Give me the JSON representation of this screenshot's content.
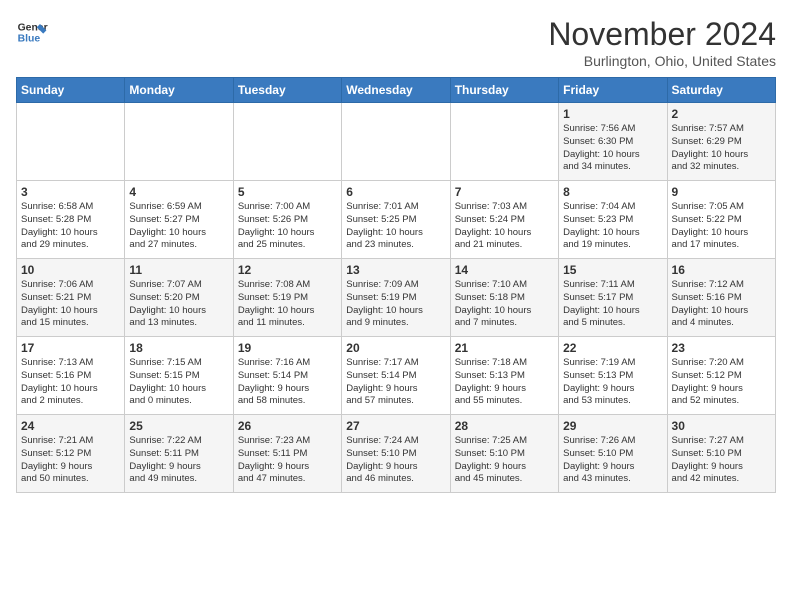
{
  "header": {
    "logo_line1": "General",
    "logo_line2": "Blue",
    "month_year": "November 2024",
    "location": "Burlington, Ohio, United States"
  },
  "days_of_week": [
    "Sunday",
    "Monday",
    "Tuesday",
    "Wednesday",
    "Thursday",
    "Friday",
    "Saturday"
  ],
  "weeks": [
    [
      {
        "day": "",
        "info": ""
      },
      {
        "day": "",
        "info": ""
      },
      {
        "day": "",
        "info": ""
      },
      {
        "day": "",
        "info": ""
      },
      {
        "day": "",
        "info": ""
      },
      {
        "day": "1",
        "info": "Sunrise: 7:56 AM\nSunset: 6:30 PM\nDaylight: 10 hours\nand 34 minutes."
      },
      {
        "day": "2",
        "info": "Sunrise: 7:57 AM\nSunset: 6:29 PM\nDaylight: 10 hours\nand 32 minutes."
      }
    ],
    [
      {
        "day": "3",
        "info": "Sunrise: 6:58 AM\nSunset: 5:28 PM\nDaylight: 10 hours\nand 29 minutes."
      },
      {
        "day": "4",
        "info": "Sunrise: 6:59 AM\nSunset: 5:27 PM\nDaylight: 10 hours\nand 27 minutes."
      },
      {
        "day": "5",
        "info": "Sunrise: 7:00 AM\nSunset: 5:26 PM\nDaylight: 10 hours\nand 25 minutes."
      },
      {
        "day": "6",
        "info": "Sunrise: 7:01 AM\nSunset: 5:25 PM\nDaylight: 10 hours\nand 23 minutes."
      },
      {
        "day": "7",
        "info": "Sunrise: 7:03 AM\nSunset: 5:24 PM\nDaylight: 10 hours\nand 21 minutes."
      },
      {
        "day": "8",
        "info": "Sunrise: 7:04 AM\nSunset: 5:23 PM\nDaylight: 10 hours\nand 19 minutes."
      },
      {
        "day": "9",
        "info": "Sunrise: 7:05 AM\nSunset: 5:22 PM\nDaylight: 10 hours\nand 17 minutes."
      }
    ],
    [
      {
        "day": "10",
        "info": "Sunrise: 7:06 AM\nSunset: 5:21 PM\nDaylight: 10 hours\nand 15 minutes."
      },
      {
        "day": "11",
        "info": "Sunrise: 7:07 AM\nSunset: 5:20 PM\nDaylight: 10 hours\nand 13 minutes."
      },
      {
        "day": "12",
        "info": "Sunrise: 7:08 AM\nSunset: 5:19 PM\nDaylight: 10 hours\nand 11 minutes."
      },
      {
        "day": "13",
        "info": "Sunrise: 7:09 AM\nSunset: 5:19 PM\nDaylight: 10 hours\nand 9 minutes."
      },
      {
        "day": "14",
        "info": "Sunrise: 7:10 AM\nSunset: 5:18 PM\nDaylight: 10 hours\nand 7 minutes."
      },
      {
        "day": "15",
        "info": "Sunrise: 7:11 AM\nSunset: 5:17 PM\nDaylight: 10 hours\nand 5 minutes."
      },
      {
        "day": "16",
        "info": "Sunrise: 7:12 AM\nSunset: 5:16 PM\nDaylight: 10 hours\nand 4 minutes."
      }
    ],
    [
      {
        "day": "17",
        "info": "Sunrise: 7:13 AM\nSunset: 5:16 PM\nDaylight: 10 hours\nand 2 minutes."
      },
      {
        "day": "18",
        "info": "Sunrise: 7:15 AM\nSunset: 5:15 PM\nDaylight: 10 hours\nand 0 minutes."
      },
      {
        "day": "19",
        "info": "Sunrise: 7:16 AM\nSunset: 5:14 PM\nDaylight: 9 hours\nand 58 minutes."
      },
      {
        "day": "20",
        "info": "Sunrise: 7:17 AM\nSunset: 5:14 PM\nDaylight: 9 hours\nand 57 minutes."
      },
      {
        "day": "21",
        "info": "Sunrise: 7:18 AM\nSunset: 5:13 PM\nDaylight: 9 hours\nand 55 minutes."
      },
      {
        "day": "22",
        "info": "Sunrise: 7:19 AM\nSunset: 5:13 PM\nDaylight: 9 hours\nand 53 minutes."
      },
      {
        "day": "23",
        "info": "Sunrise: 7:20 AM\nSunset: 5:12 PM\nDaylight: 9 hours\nand 52 minutes."
      }
    ],
    [
      {
        "day": "24",
        "info": "Sunrise: 7:21 AM\nSunset: 5:12 PM\nDaylight: 9 hours\nand 50 minutes."
      },
      {
        "day": "25",
        "info": "Sunrise: 7:22 AM\nSunset: 5:11 PM\nDaylight: 9 hours\nand 49 minutes."
      },
      {
        "day": "26",
        "info": "Sunrise: 7:23 AM\nSunset: 5:11 PM\nDaylight: 9 hours\nand 47 minutes."
      },
      {
        "day": "27",
        "info": "Sunrise: 7:24 AM\nSunset: 5:10 PM\nDaylight: 9 hours\nand 46 minutes."
      },
      {
        "day": "28",
        "info": "Sunrise: 7:25 AM\nSunset: 5:10 PM\nDaylight: 9 hours\nand 45 minutes."
      },
      {
        "day": "29",
        "info": "Sunrise: 7:26 AM\nSunset: 5:10 PM\nDaylight: 9 hours\nand 43 minutes."
      },
      {
        "day": "30",
        "info": "Sunrise: 7:27 AM\nSunset: 5:10 PM\nDaylight: 9 hours\nand 42 minutes."
      }
    ]
  ]
}
